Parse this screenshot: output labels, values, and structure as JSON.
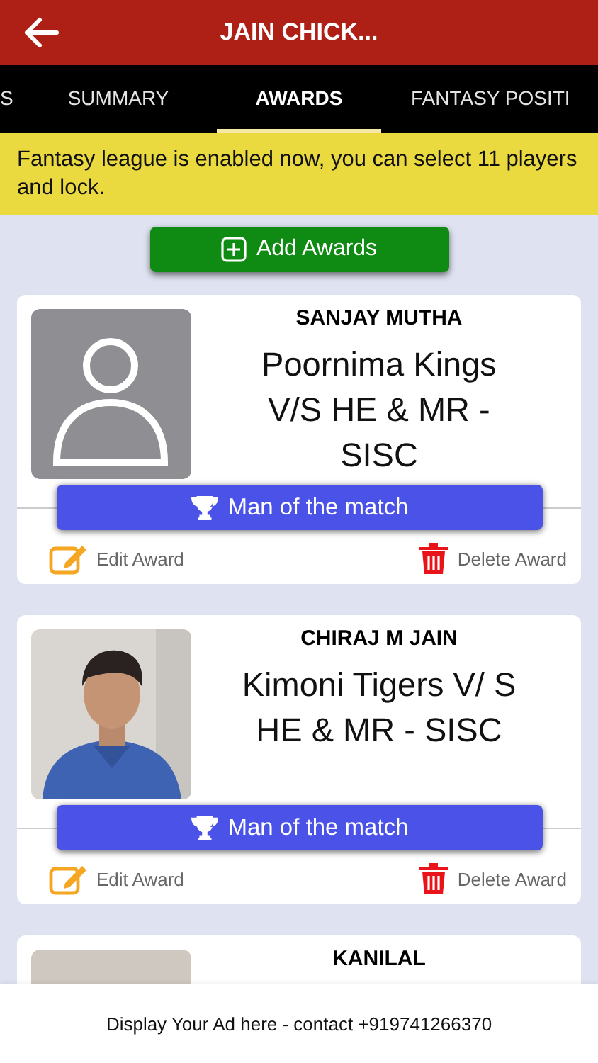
{
  "header": {
    "title": "JAIN CHICK..."
  },
  "tabs": [
    {
      "label": "S",
      "selected": false
    },
    {
      "label": "SUMMARY",
      "selected": false
    },
    {
      "label": "AWARDS",
      "selected": true
    },
    {
      "label": "FANTASY POSITI",
      "selected": false
    }
  ],
  "notice": "Fantasy league is enabled now, you can select 11 players and lock.",
  "add_button": "Add Awards",
  "awards": [
    {
      "player": "SANJAY MUTHA",
      "image": {
        "kind": "placeholder"
      },
      "match": "Poornima Kings V/S HE & MR - SISC",
      "award": "Man of the match",
      "edit": "Edit Award",
      "delete": "Delete Award"
    },
    {
      "player": "CHIRAJ M JAIN",
      "match": "Kimoni Tigers V/ S HE & MR - SISC",
      "award": "Man of the match",
      "edit": "Edit Award",
      "delete": "Delete Award"
    },
    {
      "player": "KANILAL",
      "image": {
        "kind": "placeholder-light"
      }
    }
  ],
  "ad_bar": "Display Your Ad here - contact +919741266370"
}
